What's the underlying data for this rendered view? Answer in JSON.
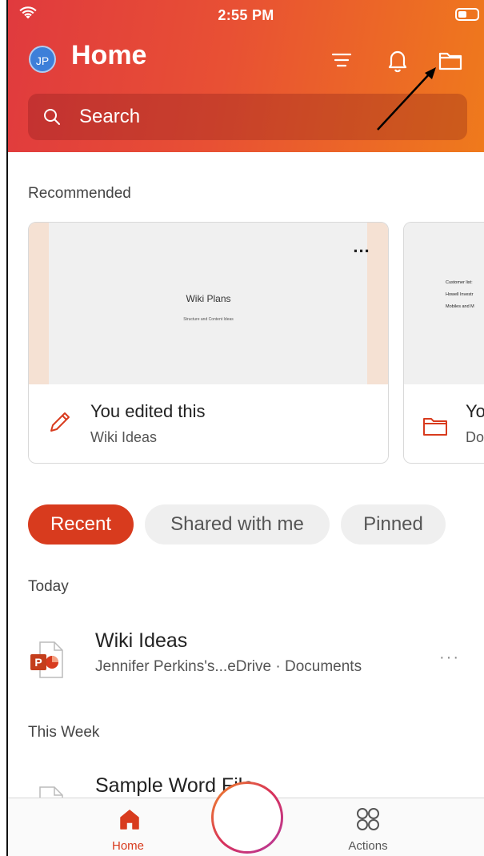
{
  "status_bar": {
    "time": "2:55 PM"
  },
  "header": {
    "avatar_initials": "JP",
    "title": "Home",
    "icons": [
      "filter-icon",
      "bell-icon",
      "folder-icon"
    ]
  },
  "search": {
    "placeholder": "Search"
  },
  "recommended": {
    "label": "Recommended",
    "cards": [
      {
        "thumb_title": "Wiki Plans",
        "thumb_subtitle": "Structure and Content Ideas",
        "activity": "You edited this",
        "file": "Wiki Ideas",
        "icon": "pencil-icon",
        "more": "..."
      },
      {
        "thumb_lines": [
          "Customer list:",
          "Howell Investr",
          "Mobiles and M"
        ],
        "activity": "Yo",
        "file": "Do",
        "icon": "folder-icon"
      }
    ]
  },
  "tabs": [
    {
      "label": "Recent",
      "active": true
    },
    {
      "label": "Shared with me",
      "active": false
    },
    {
      "label": "Pinned",
      "active": false
    }
  ],
  "sections": {
    "today": "Today",
    "this_week": "This Week"
  },
  "files": [
    {
      "name": "Wiki Ideas",
      "path": "Jennifer Perkins's...eDrive · Documents",
      "type": "powerpoint",
      "more": "···"
    },
    {
      "name": "Sample Word File",
      "type": "word",
      "more": "···"
    }
  ],
  "bottom_nav": {
    "home_label": "Home",
    "actions_label": "Actions",
    "fab_label": "+"
  },
  "colors": {
    "accent": "#d83b1e",
    "header_start": "#e03a3e",
    "header_end": "#ef7a1c",
    "word_blue": "#2b5fb7"
  }
}
